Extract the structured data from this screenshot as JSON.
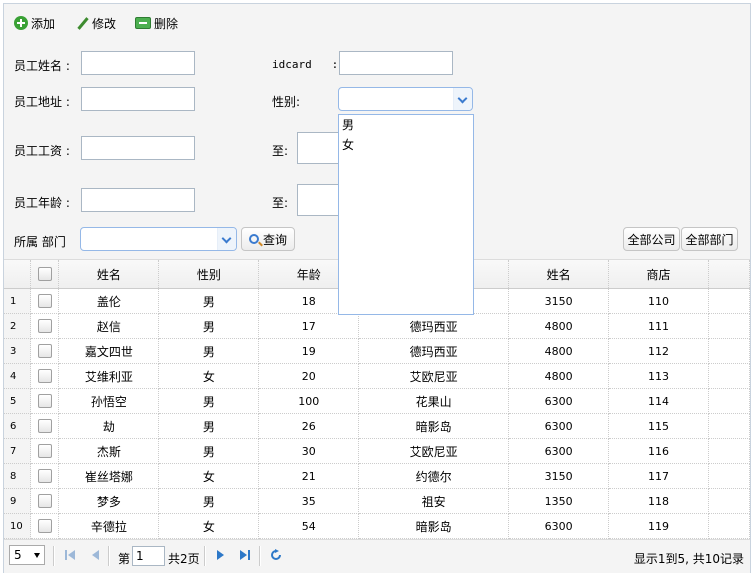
{
  "toolbar": {
    "add": "添加",
    "edit": "修改",
    "delete": "删除"
  },
  "form": {
    "name_label": "员工姓名 :",
    "idcard_label": "idcard   :",
    "address_label": "员工地址 :",
    "gender_label": "性别:",
    "salary_label": "员工工资 :",
    "salary_to": "至:",
    "age_label": "员工年龄 :",
    "age_to": "至:",
    "dept_label": "所属 部门",
    "query": "查询",
    "all_company": "全部公司",
    "all_dept": "全部部门"
  },
  "gender_options": [
    "男",
    "女"
  ],
  "table": {
    "headers": [
      "姓名",
      "性别",
      "年龄",
      "",
      "姓名",
      "商店"
    ],
    "rows": [
      [
        "1",
        "盖伦",
        "男",
        "18",
        "",
        "3150",
        "110"
      ],
      [
        "2",
        "赵信",
        "男",
        "17",
        "德玛西亚",
        "4800",
        "111"
      ],
      [
        "3",
        "嘉文四世",
        "男",
        "19",
        "德玛西亚",
        "4800",
        "112"
      ],
      [
        "4",
        "艾维利亚",
        "女",
        "20",
        "艾欧尼亚",
        "4800",
        "113"
      ],
      [
        "5",
        "孙悟空",
        "男",
        "100",
        "花果山",
        "6300",
        "114"
      ],
      [
        "6",
        "劫",
        "男",
        "26",
        "暗影岛",
        "6300",
        "115"
      ],
      [
        "7",
        "杰斯",
        "男",
        "30",
        "艾欧尼亚",
        "6300",
        "116"
      ],
      [
        "8",
        "崔丝塔娜",
        "女",
        "21",
        "约德尔",
        "3150",
        "117"
      ],
      [
        "9",
        "梦多",
        "男",
        "35",
        "祖安",
        "1350",
        "118"
      ],
      [
        "10",
        "辛德拉",
        "女",
        "54",
        "暗影岛",
        "6300",
        "119"
      ]
    ]
  },
  "pager": {
    "page_size": "5",
    "page_prefix": "第",
    "page_value": "1",
    "page_total": "共2页",
    "summary": "显示1到5, 共10记录"
  }
}
